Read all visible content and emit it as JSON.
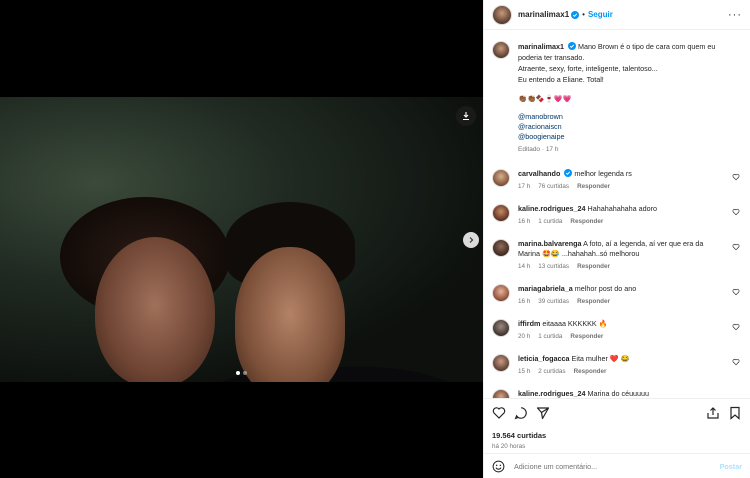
{
  "header": {
    "username": "marinalimax1",
    "dot": "•",
    "follow_label": "Seguir",
    "more_label": "···"
  },
  "caption": {
    "username": "marinalimax1",
    "lines": [
      "Mano Brown é o tipo de cara com quem eu",
      "poderia ter transado.",
      "Atraente, sexy, forte, inteligente, talentoso...",
      "Eu entendo a Eliane. Total!"
    ],
    "emojis": "👏🏾👏🏾🍫🍷💗💗",
    "links": [
      "@manobrown",
      "@racionaiscn",
      "@boogienaipe"
    ],
    "meta": "Editado · 17 h"
  },
  "comments": [
    {
      "username": "carvalhando",
      "verified": true,
      "text": "melhor legenda rs",
      "time": "17 h",
      "likes": "76 curtidas",
      "reply": "Responder"
    },
    {
      "username": "kaline.rodrigues_24",
      "verified": false,
      "text": "Hahahahahaha adoro",
      "time": "16 h",
      "likes": "1 curtida",
      "reply": "Responder"
    },
    {
      "username": "marina.balvarenga",
      "verified": false,
      "text": "A foto, aí a legenda, aí ver que era da",
      "text2": "Marina 🤩😂 ...hahahah..só melhorou",
      "time": "14 h",
      "likes": "13 curtidas",
      "reply": "Responder"
    },
    {
      "username": "mariagabriela_a",
      "verified": false,
      "text": "melhor post do ano",
      "time": "16 h",
      "likes": "39 curtidas",
      "reply": "Responder"
    },
    {
      "username": "iffirdm",
      "verified": false,
      "text": "eitaaaa KKKKKK 🔥",
      "time": "20 h",
      "likes": "1 curtida",
      "reply": "Responder"
    },
    {
      "username": "leticia_fogacca",
      "verified": false,
      "text": "Eita mulher ❤️ 😂",
      "time": "15 h",
      "likes": "2 curtidas",
      "reply": "Responder"
    },
    {
      "username": "kaline.rodrigues_24",
      "verified": false,
      "text": "Marina do céuuuuu",
      "time": "",
      "likes": "",
      "reply": ""
    }
  ],
  "footer": {
    "likes": "19.564 curtidas",
    "time": "há 20 horas",
    "comment_placeholder": "Adicione um comentário...",
    "post_label": "Postar"
  },
  "colors": {
    "link": "#00376b",
    "accent": "#0095f6",
    "muted": "#737373"
  }
}
